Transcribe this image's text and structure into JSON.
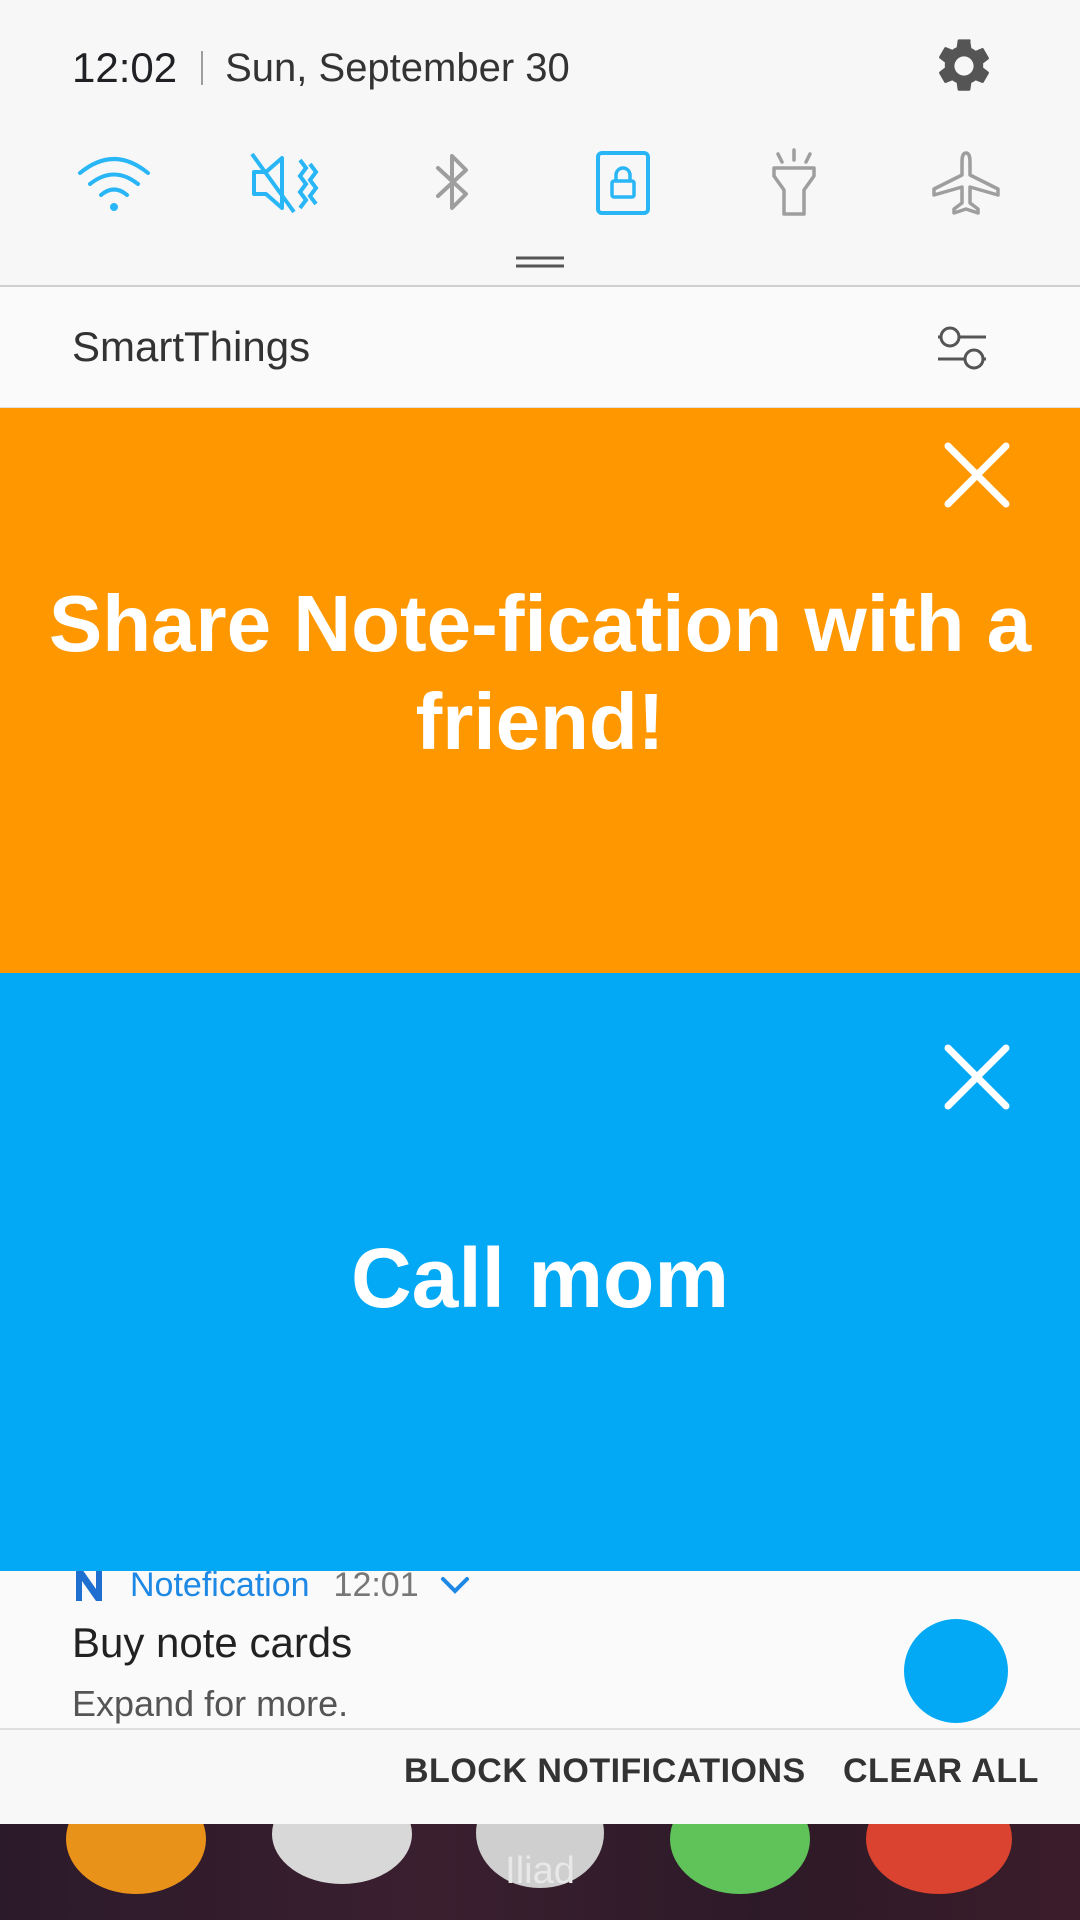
{
  "status": {
    "time": "12:02",
    "date": "Sun, September 30"
  },
  "quick_toggles": [
    {
      "name": "wifi",
      "active": true
    },
    {
      "name": "sound-muted",
      "active": true
    },
    {
      "name": "bluetooth",
      "active": false
    },
    {
      "name": "rotation-lock",
      "active": true
    },
    {
      "name": "flashlight",
      "active": false
    },
    {
      "name": "airplane-mode",
      "active": false
    }
  ],
  "smartthings": {
    "label": "SmartThings"
  },
  "cards": {
    "share": {
      "text": "Share Note-fication with a friend!",
      "color": "#ff9800"
    },
    "mom": {
      "text": "Call mom",
      "color": "#03a9f4"
    }
  },
  "notification": {
    "app_name": "Notefication",
    "time": "12:01",
    "title": "Buy note cards",
    "body": "Expand for more."
  },
  "actions": {
    "block": "BLOCK NOTIFICATIONS",
    "clear": "CLEAR ALL"
  },
  "home": {
    "label": "Iliad"
  },
  "colors": {
    "accent_blue": "#29b6f6",
    "inactive_gray": "#9e9e9e"
  }
}
